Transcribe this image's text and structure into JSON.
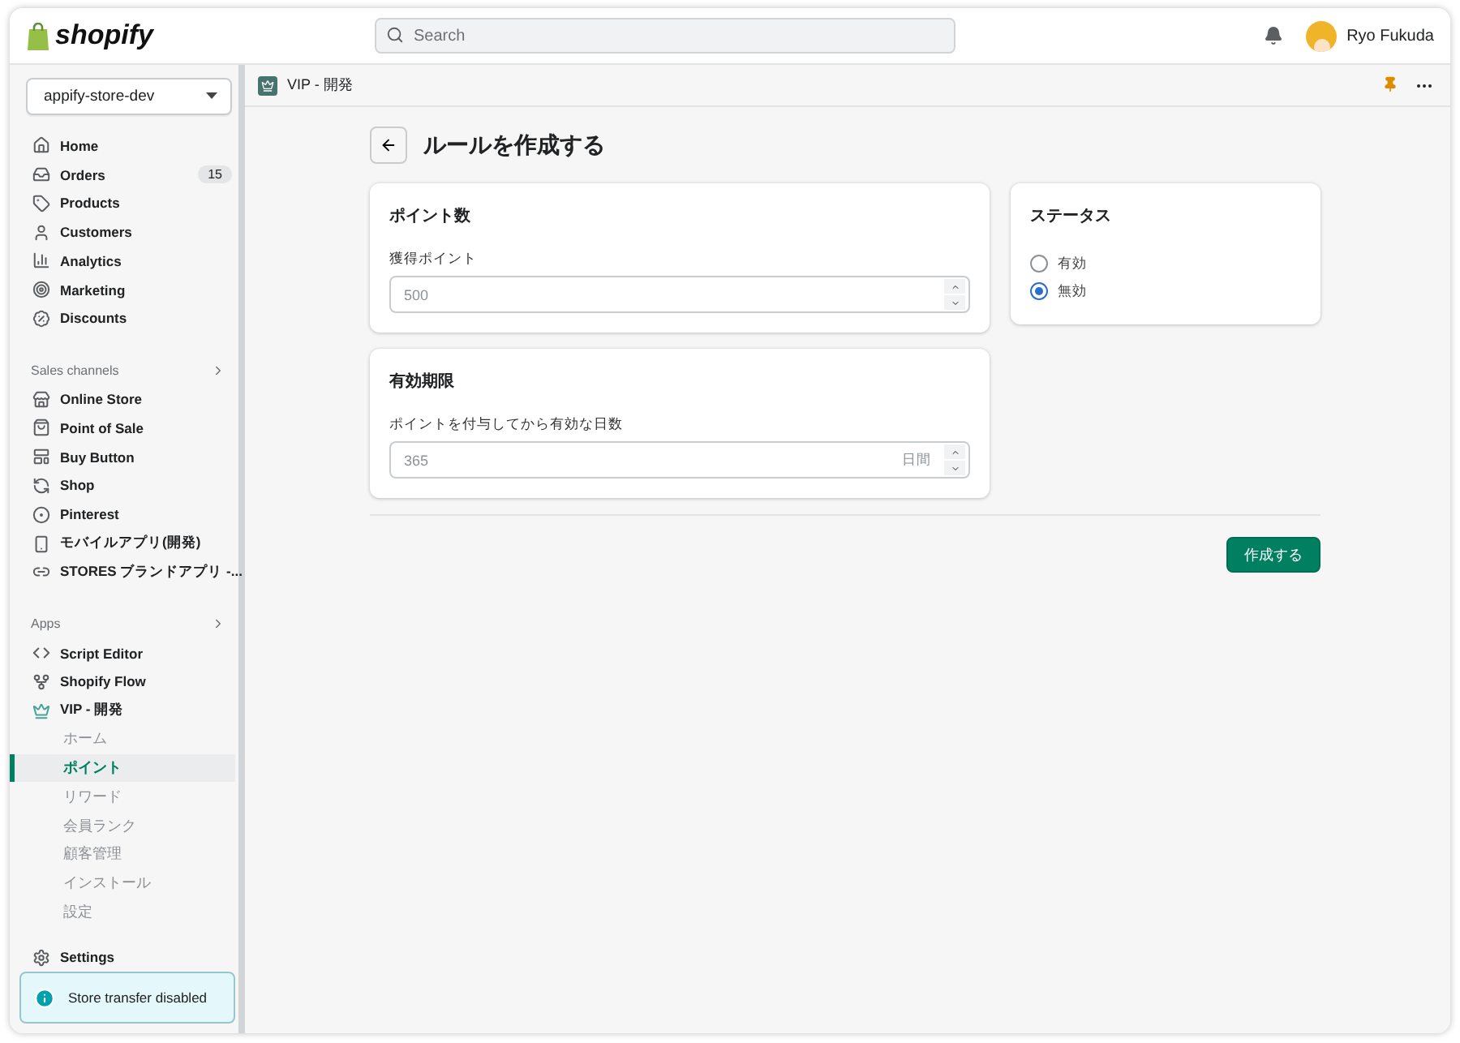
{
  "topbar": {
    "logo": "shopify",
    "search": {
      "placeholder": "Search"
    },
    "user": "Ryo Fukuda"
  },
  "sidebar": {
    "store": "appify-store-dev",
    "nav": [
      {
        "label": "Home"
      },
      {
        "label": "Orders",
        "badge": "15"
      },
      {
        "label": "Products"
      },
      {
        "label": "Customers"
      },
      {
        "label": "Analytics"
      },
      {
        "label": "Marketing"
      },
      {
        "label": "Discounts"
      }
    ],
    "sales_channels": {
      "title": "Sales channels",
      "items": [
        {
          "label": "Online Store"
        },
        {
          "label": "Point of Sale"
        },
        {
          "label": "Buy Button"
        },
        {
          "label": "Shop"
        },
        {
          "label": "Pinterest"
        },
        {
          "label": "モバイルアプリ(開発)"
        },
        {
          "label": "STORES ブランドアプリ -..."
        }
      ]
    },
    "apps": {
      "title": "Apps",
      "items": [
        {
          "label": "Script Editor"
        },
        {
          "label": "Shopify Flow"
        },
        {
          "label": "VIP - 開発",
          "children": [
            {
              "label": "ホーム",
              "selected": false
            },
            {
              "label": "ポイント",
              "selected": true
            },
            {
              "label": "リワード",
              "selected": false
            },
            {
              "label": "会員ランク",
              "selected": false
            },
            {
              "label": "顧客管理",
              "selected": false
            },
            {
              "label": "インストール",
              "selected": false
            },
            {
              "label": "設定",
              "selected": false
            }
          ]
        }
      ]
    },
    "settings": "Settings",
    "notice": "Store transfer disabled"
  },
  "app_bar": {
    "title": "VIP - 開発"
  },
  "page": {
    "title": "ルールを作成する",
    "points_card": {
      "title": "ポイント数",
      "field": {
        "label": "獲得ポイント",
        "placeholder": "500"
      }
    },
    "expiry_card": {
      "title": "有効期限",
      "field": {
        "label": "ポイントを付与してから有効な日数",
        "placeholder": "365",
        "suffix": "日間"
      }
    },
    "status_card": {
      "title": "ステータス",
      "options": [
        {
          "label": "有効",
          "selected": false
        },
        {
          "label": "無効",
          "selected": true
        }
      ]
    },
    "submit": "作成する"
  }
}
